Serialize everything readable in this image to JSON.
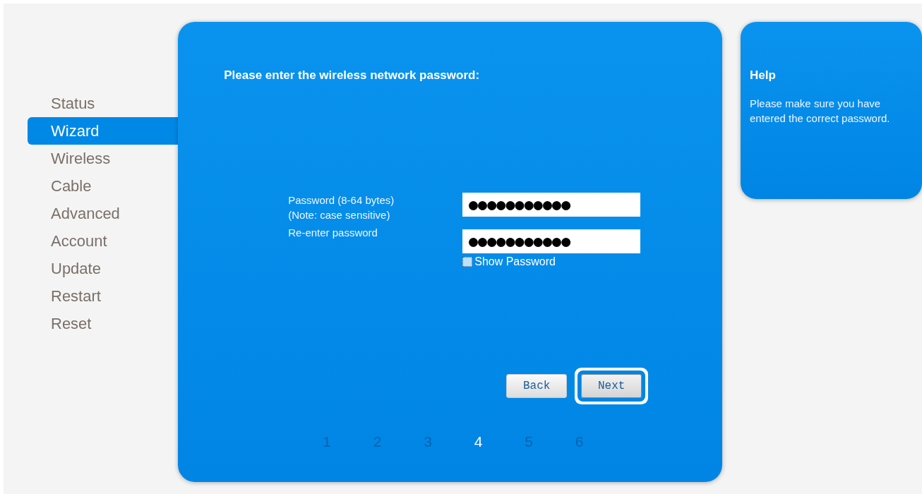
{
  "sidebar": {
    "items": [
      {
        "label": "Status",
        "selected": false
      },
      {
        "label": "Wizard",
        "selected": true
      },
      {
        "label": "Wireless",
        "selected": false
      },
      {
        "label": "Cable",
        "selected": false
      },
      {
        "label": "Advanced",
        "selected": false
      },
      {
        "label": "Account",
        "selected": false
      },
      {
        "label": "Update",
        "selected": false
      },
      {
        "label": "Restart",
        "selected": false
      },
      {
        "label": "Reset",
        "selected": false
      }
    ]
  },
  "wizard": {
    "heading": "Please enter the wireless network password:",
    "fields": [
      {
        "label": "Password (8-64 bytes)",
        "note": "(Note: case sensitive)",
        "value": "●●●●●●●●●●●"
      },
      {
        "label": "Re-enter password",
        "value": "●●●●●●●●●●●"
      }
    ],
    "show_password": {
      "label": "Show Password",
      "checked": false
    },
    "buttons": [
      {
        "label": "Back",
        "focused": false
      },
      {
        "label": "Next",
        "focused": true
      }
    ],
    "steps": [
      {
        "label": "1",
        "selected": false
      },
      {
        "label": "2",
        "selected": false
      },
      {
        "label": "3",
        "selected": false
      },
      {
        "label": "4",
        "selected": true
      },
      {
        "label": "5",
        "selected": false
      },
      {
        "label": "6",
        "selected": false
      }
    ]
  },
  "help": {
    "title": "Help",
    "text": "Please make sure you have entered the correct password."
  }
}
